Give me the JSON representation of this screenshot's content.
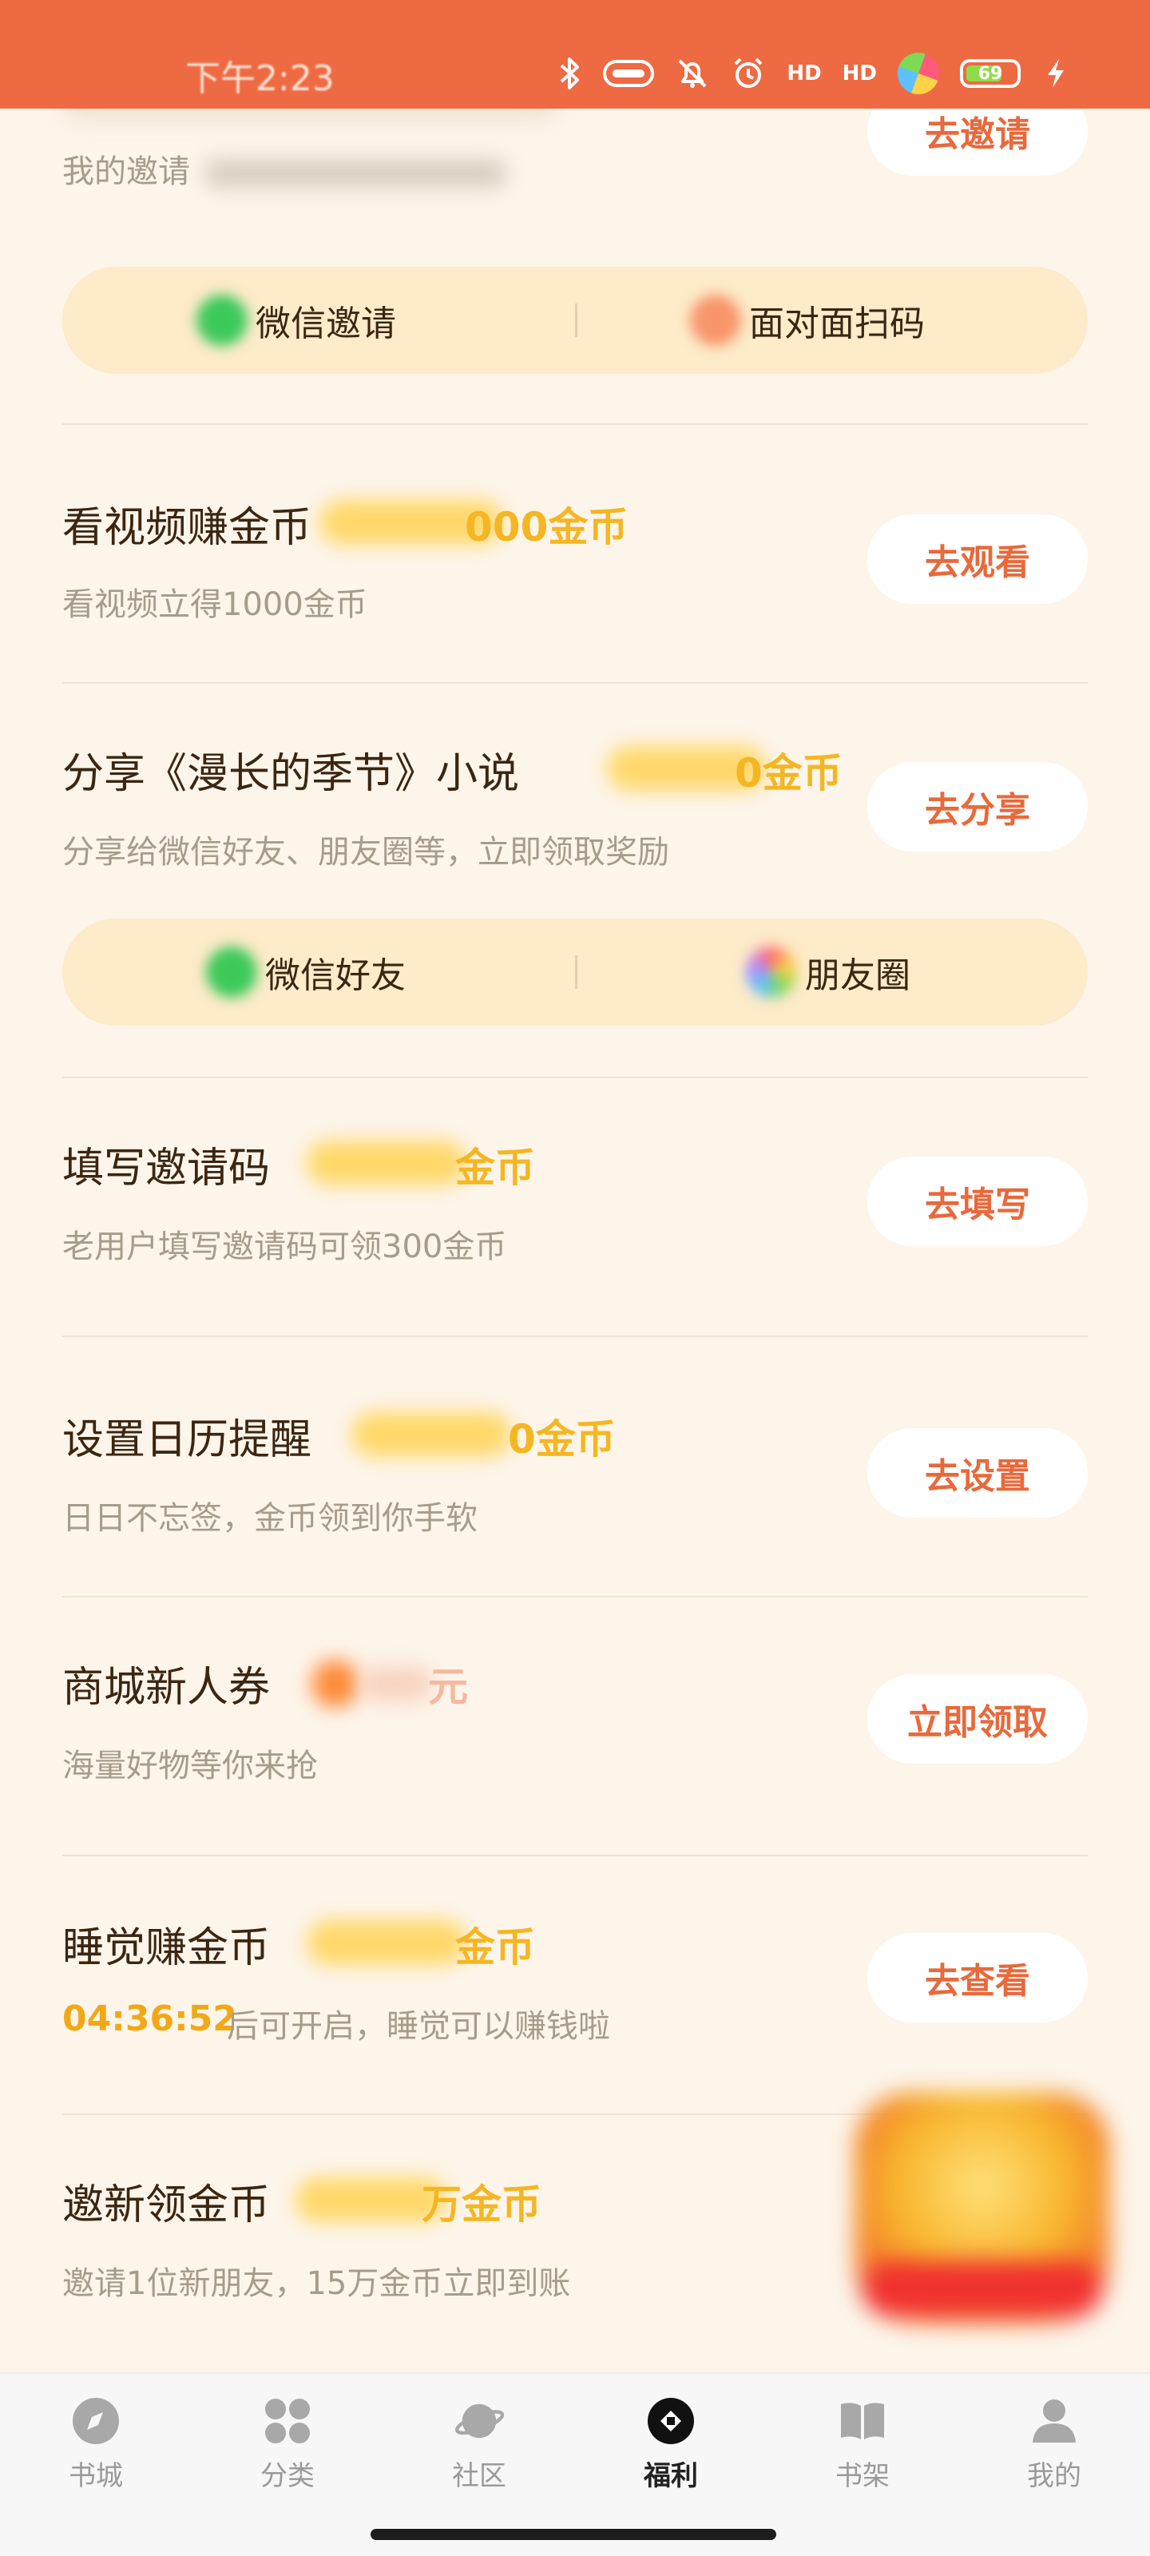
{
  "status_bar": {
    "time": "下午2:23",
    "battery": "69",
    "hd1": "HD",
    "hd2": "HD"
  },
  "invite": {
    "subtitle": "我的邀请",
    "button": "去邀请",
    "options": [
      {
        "label": "微信邀请",
        "icon": "wechat-icon"
      },
      {
        "label": "面对面扫码",
        "icon": "qrcode-icon"
      }
    ]
  },
  "tasks": [
    {
      "title": "看视频赚金币",
      "reward": "000金币",
      "desc": "看视频立得1000金币",
      "button": "去观看"
    },
    {
      "title": "分享《漫长的季节》小说",
      "reward": "0金币",
      "desc": "分享给微信好友、朋友圈等，立即领取奖励",
      "button": "去分享"
    },
    {
      "title": "填写邀请码",
      "reward": "金币",
      "desc": "老用户填写邀请码可领300金币",
      "button": "去填写"
    },
    {
      "title": "设置日历提醒",
      "reward": "0金币",
      "desc": "日日不忘签，金币领到你手软",
      "button": "去设置"
    },
    {
      "title": "商城新人券",
      "reward": "元",
      "desc": "海量好物等你来抢",
      "button": "立即领取"
    },
    {
      "title": "睡觉赚金币",
      "reward": "金币",
      "countdown": "04:36:52",
      "desc": "后可开启，睡觉可以赚钱啦",
      "button": "去查看"
    },
    {
      "title": "邀新领金币",
      "reward": "万金币",
      "desc": "邀请1位新朋友，15万金币立即到账",
      "button": ""
    }
  ],
  "share_options": [
    {
      "label": "微信好友",
      "icon": "wechat-icon"
    },
    {
      "label": "朋友圈",
      "icon": "moments-icon"
    }
  ],
  "nav": [
    {
      "label": "书城",
      "icon": "compass-icon",
      "active": false
    },
    {
      "label": "分类",
      "icon": "grid-icon",
      "active": false
    },
    {
      "label": "社区",
      "icon": "planet-icon",
      "active": false
    },
    {
      "label": "福利",
      "icon": "gift-icon",
      "active": true
    },
    {
      "label": "书架",
      "icon": "book-icon",
      "active": false
    },
    {
      "label": "我的",
      "icon": "user-icon",
      "active": false
    }
  ],
  "colors": {
    "accent": "#ee6a43",
    "background": "#fdf5ea",
    "gold": "#f5b623",
    "button_text": "#e8693b"
  }
}
